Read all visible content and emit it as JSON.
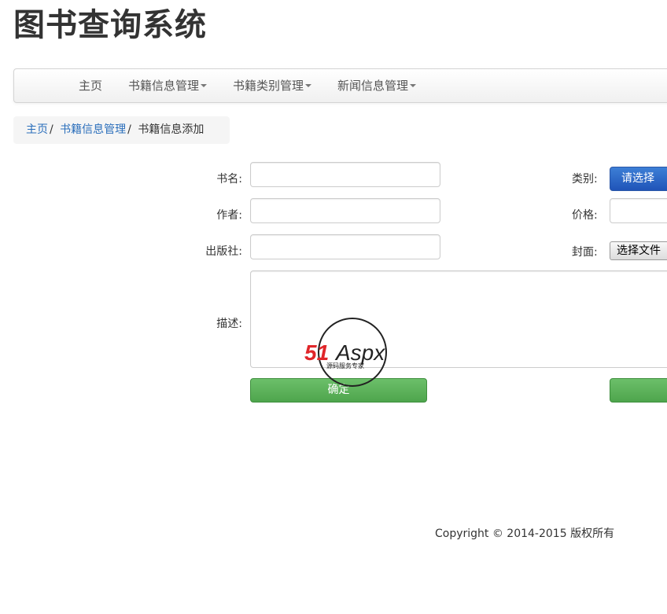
{
  "app": {
    "title": "图书查询系统"
  },
  "nav": {
    "items": [
      {
        "label": "主页"
      },
      {
        "label": "书籍信息管理"
      },
      {
        "label": "书籍类别管理"
      },
      {
        "label": "新闻信息管理"
      }
    ]
  },
  "breadcrumb": {
    "home": "主页",
    "section": "书籍信息管理",
    "current": "书籍信息添加",
    "separator": "/"
  },
  "form": {
    "book_name_label": "书名:",
    "author_label": "作者:",
    "publisher_label": "出版社:",
    "description_label": "描述:",
    "category_label": "类别:",
    "category_value": "请选择",
    "price_label": "价格:",
    "cover_label": "封面:",
    "cover_button": "选择文件",
    "book_name_value": "",
    "author_value": "",
    "publisher_value": "",
    "price_value": "",
    "description_value": "",
    "confirm_button": "确定"
  },
  "watermark": {
    "brand_red": "51",
    "brand_black": "Aspx",
    "tagline": "源码服务专家"
  },
  "footer": {
    "copyright": "Copyright © 2014-2015 版权所有"
  },
  "colors": {
    "primary": "#2a5fc4",
    "success": "#5cb35a",
    "link": "#2a6ebb",
    "watermark_red": "#e0262a",
    "watermark_green": "#2fae3a"
  }
}
